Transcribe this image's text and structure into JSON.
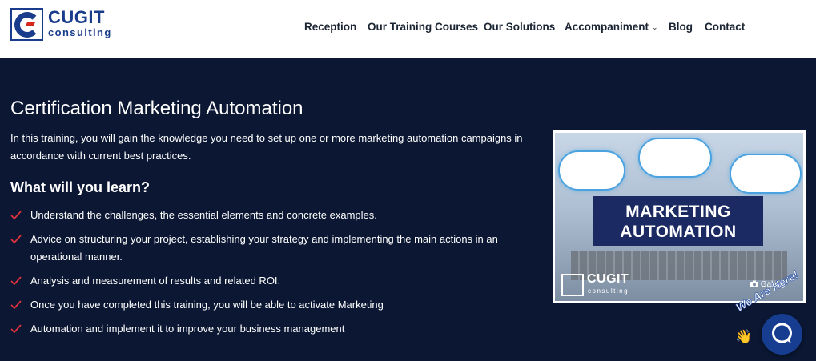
{
  "header": {
    "logo": {
      "title": "CUGIT",
      "subtitle": "consulting"
    },
    "nav": [
      {
        "label": "Reception"
      },
      {
        "label": "Our Training Courses"
      },
      {
        "label": "Our Solutions"
      },
      {
        "label": "Accompaniment",
        "has_dropdown": true
      },
      {
        "label": "Blog"
      },
      {
        "label": "Contact"
      }
    ]
  },
  "main": {
    "title": "Certification Marketing Automation",
    "intro": "In this training, you will gain the knowledge you need to set up one or more marketing automation campaigns in accordance with current best practices.",
    "learn_heading": "What will you learn?",
    "learn_items": [
      "Understand the challenges, the essential elements and concrete examples.",
      "Advice on structuring your project, establishing your strategy and implementing the main actions in an operational manner.",
      "Analysis and measurement of results and related ROI.",
      "Once you have completed this training, you will be able to activate Marketing",
      "Automation and implement it to improve your business management"
    ]
  },
  "image": {
    "banner_line1": "MARKETING",
    "banner_line2": "AUTOMATION",
    "watermark_title": "CUGIT",
    "watermark_sub": "consulting",
    "gallery_label": "Gallery"
  },
  "chat_widget": {
    "tagline": "We Are Here!"
  },
  "colors": {
    "page_bg": "#0b1733",
    "brand_blue": "#1a3c8c",
    "check_red": "#e0323c",
    "chat_button": "#163d8f"
  },
  "icons": {
    "check": "check-icon",
    "chevron": "chevron-down-icon",
    "camera": "camera-icon",
    "chat": "chat-bubble-icon",
    "wave": "waving-hand-icon"
  }
}
